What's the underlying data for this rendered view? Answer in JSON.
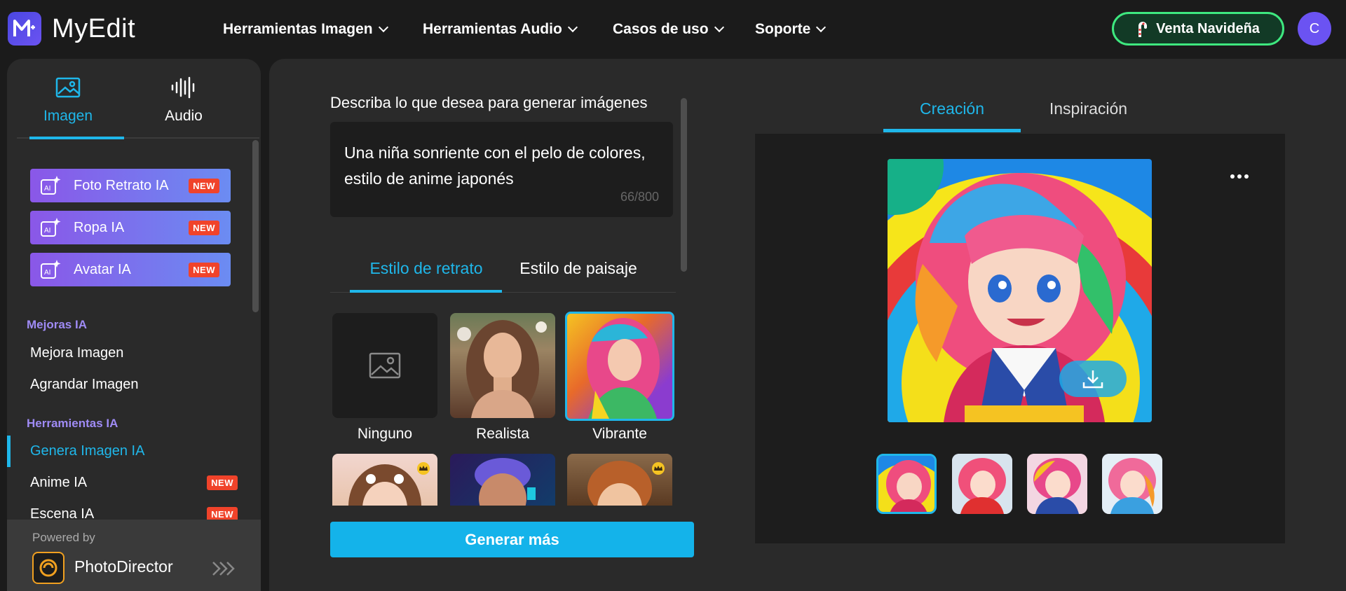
{
  "app": {
    "name": "MyEdit"
  },
  "nav": {
    "items": [
      "Herramientas Imagen",
      "Herramientas Audio",
      "Casos de uso",
      "Soporte"
    ]
  },
  "promo": {
    "label": "Venta Navideña"
  },
  "user": {
    "initial": "C"
  },
  "sidebar": {
    "tabs": [
      {
        "label": "Imagen",
        "active": true
      },
      {
        "label": "Audio",
        "active": false
      }
    ],
    "featured": [
      {
        "label": "Foto Retrato IA",
        "badge": "NEW"
      },
      {
        "label": "Ropa IA",
        "badge": "NEW"
      },
      {
        "label": "Avatar IA",
        "badge": "NEW"
      }
    ],
    "sections": [
      {
        "heading": "Mejoras IA",
        "items": [
          {
            "label": "Mejora Imagen"
          },
          {
            "label": "Agrandar Imagen"
          }
        ]
      },
      {
        "heading": "Herramientas IA",
        "items": [
          {
            "label": "Genera Imagen IA",
            "active": true
          },
          {
            "label": "Anime IA",
            "badge": "NEW"
          },
          {
            "label": "Escena IA",
            "badge": "NEW"
          }
        ]
      }
    ],
    "powered": {
      "caption": "Powered by",
      "product": "PhotoDirector"
    }
  },
  "prompt": {
    "label": "Describa lo que desea para generar imágenes",
    "text": "Una niña sonriente con el pelo de colores, estilo de anime japonés",
    "counter": "66/800"
  },
  "style_tabs": [
    {
      "label": "Estilo de retrato",
      "active": true
    },
    {
      "label": "Estilo de paisaje",
      "active": false
    }
  ],
  "styles": [
    {
      "label": "Ninguno"
    },
    {
      "label": "Realista"
    },
    {
      "label": "Vibrante",
      "selected": true
    }
  ],
  "generate_button": {
    "label": "Generar más"
  },
  "result_tabs": [
    {
      "label": "Creación",
      "active": true
    },
    {
      "label": "Inspiración",
      "active": false
    }
  ],
  "colors": {
    "accent": "#1fb7ea",
    "purple": "#8a57e8",
    "badge": "#f0432a"
  }
}
